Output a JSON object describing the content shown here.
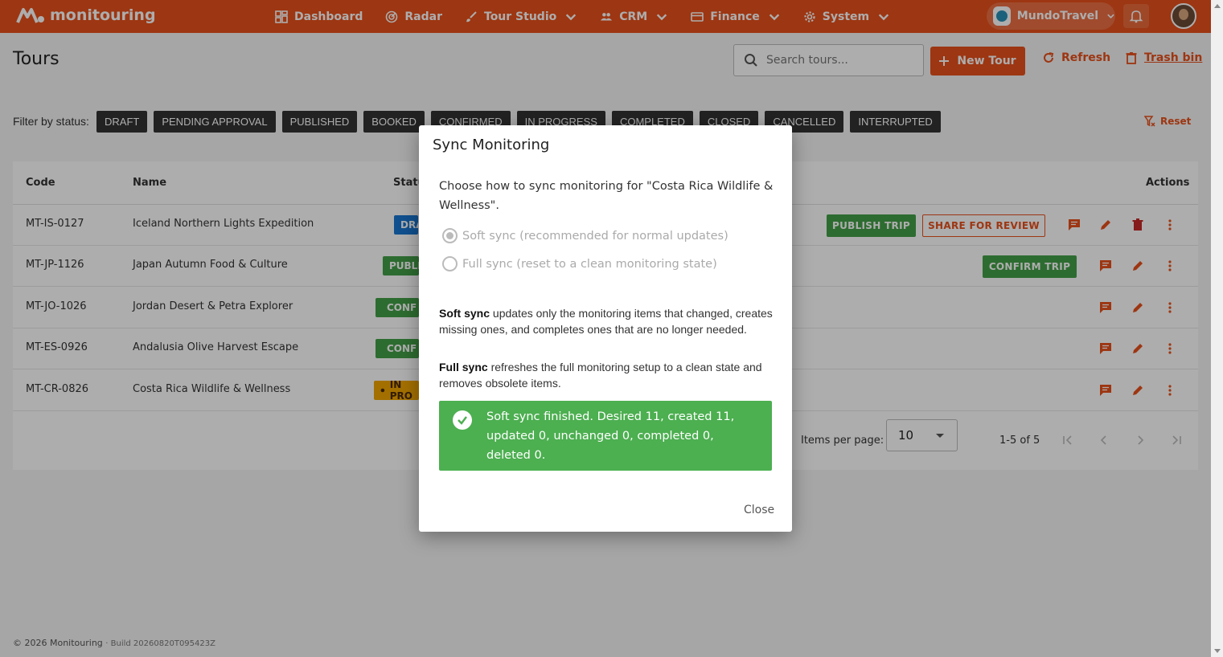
{
  "brand": {
    "name": "monitouring"
  },
  "nav": [
    {
      "label": "Dashboard",
      "icon": "dashboard-icon",
      "dropdown": false
    },
    {
      "label": "Radar",
      "icon": "radar-icon",
      "dropdown": false
    },
    {
      "label": "Tour Studio",
      "icon": "brush-icon",
      "dropdown": true
    },
    {
      "label": "CRM",
      "icon": "people-icon",
      "dropdown": true
    },
    {
      "label": "Finance",
      "icon": "card-icon",
      "dropdown": true
    },
    {
      "label": "System",
      "icon": "gear-icon",
      "dropdown": true
    }
  ],
  "org": {
    "name": "MundoTravel"
  },
  "page": {
    "title": "Tours"
  },
  "search": {
    "placeholder": "Search tours..."
  },
  "toolbar": {
    "new_label": "New Tour",
    "refresh_label": "Refresh",
    "trash_label": "Trash bin"
  },
  "filters": {
    "label": "Filter by status:",
    "chips": [
      "DRAFT",
      "PENDING APPROVAL",
      "PUBLISHED",
      "BOOKED",
      "CONFIRMED",
      "IN PROGRESS",
      "COMPLETED",
      "CLOSED",
      "CANCELLED",
      "INTERRUPTED"
    ],
    "reset_label": "Reset"
  },
  "table": {
    "columns": {
      "code": "Code",
      "name": "Name",
      "status": "Statu",
      "actions": "Actions"
    },
    "rows": [
      {
        "code": "MT-IS-0127",
        "name": "Iceland Northern Lights Expedition",
        "status": "DRA",
        "primary_action": "PUBLISH TRIP",
        "secondary_action": "SHARE FOR REVIEW"
      },
      {
        "code": "MT-JP-1126",
        "name": "Japan Autumn Food & Culture",
        "status": "PUBLI",
        "primary_action": "CONFIRM TRIP"
      },
      {
        "code": "MT-JO-1026",
        "name": "Jordan Desert & Petra Explorer",
        "status": "CONF"
      },
      {
        "code": "MT-ES-0926",
        "name": "Andalusia Olive Harvest Escape",
        "status": "CONF"
      },
      {
        "code": "MT-CR-0826",
        "name": "Costa Rica Wildlife & Wellness",
        "status": "IN PRO"
      }
    ]
  },
  "pagination": {
    "items_per_page_label": "Items per page:",
    "items_per_page": "10",
    "range": "1-5 of 5"
  },
  "footer": {
    "copyright": "© 2026 Monitouring",
    "build": "· Build 20260820T095423Z"
  },
  "dialog": {
    "title": "Sync Monitoring",
    "question": "Choose how to sync monitoring for \"Costa Rica Wildlife & Wellness\".",
    "soft_option": "Soft sync (recommended for normal updates)",
    "full_option": "Full sync (reset to a clean monitoring state)",
    "soft_title": "Soft sync",
    "soft_desc": " updates only the monitoring items that changed, creates missing ones, and completes ones that are no longer needed.",
    "full_title": "Full sync",
    "full_desc": " refreshes the full monitoring setup to a clean state and removes obsolete items.",
    "success_message": "Soft sync finished. Desired 11, created 11, updated 0, unchanged 0, completed 0, deleted 0.",
    "close_label": "Close"
  },
  "colors": {
    "brand": "#e8501b",
    "success": "#4caf50",
    "draft": "#1976d2",
    "published": "#43a047",
    "in_progress": "#f0a500"
  }
}
